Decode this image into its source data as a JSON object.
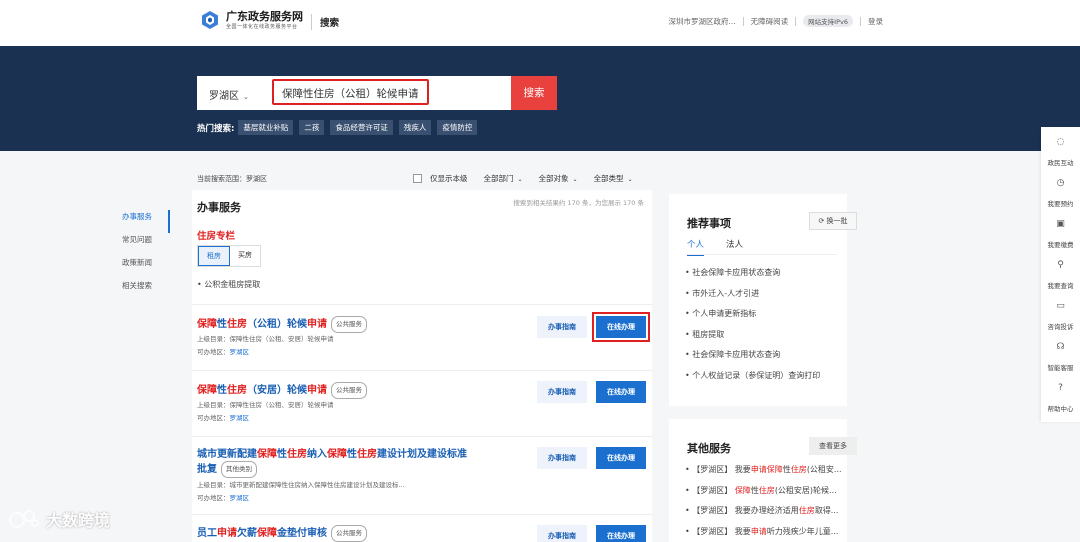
{
  "header": {
    "logo_title": "广东政务服务网",
    "logo_subtitle": "全国一体化在线政务服务平台",
    "page_label": "搜索",
    "location": "深圳市罗湖区政府...",
    "accessibility": "无障碍阅读",
    "ipv6": "网站支持IPv6",
    "login": "登录"
  },
  "search": {
    "region": "罗湖区",
    "query": "保障性住房（公租）轮候申请",
    "button": "搜索",
    "hot_label": "热门搜索:",
    "hot_tags": [
      "基层就业补贴",
      "二孩",
      "食品经营许可证",
      "残疾人",
      "疫情防控"
    ]
  },
  "filters": {
    "scope": "当前搜索范围：罗湖区",
    "sample_only": "仅显示本级",
    "department": "全部部门",
    "object": "全部对象",
    "type": "全部类型"
  },
  "side_nav": [
    "办事服务",
    "常见问题",
    "政策新闻",
    "相关搜索"
  ],
  "results": {
    "title": "办事服务",
    "count": "搜索到相关结果约 170 条，为您展示 170 条",
    "housing_title": "住房专栏",
    "tabs": [
      "租房",
      "买房"
    ],
    "gjj": "公积金租房提取",
    "guide_label": "办事指南",
    "go_label": "在线办理",
    "items": [
      {
        "title_parts": [
          [
            "保障",
            true
          ],
          [
            "性",
            false
          ],
          [
            "住房",
            true
          ],
          [
            "（公租）轮候",
            false
          ],
          [
            "申请",
            true
          ]
        ],
        "badge": "公共服务",
        "parent": "上级目录：保障性住房（公租、安居）轮候申请",
        "area_label": "可办地区：",
        "area": "罗湖区"
      },
      {
        "title_parts": [
          [
            "保障",
            true
          ],
          [
            "性",
            false
          ],
          [
            "住房",
            true
          ],
          [
            "（安居）轮候",
            false
          ],
          [
            "申请",
            true
          ]
        ],
        "badge": "公共服务",
        "parent": "上级目录：保障性住房（公租、安居）轮候申请",
        "area_label": "可办地区：",
        "area": "罗湖区"
      },
      {
        "title_parts": [
          [
            "城市更新配建",
            false
          ],
          [
            "保障",
            true
          ],
          [
            "性",
            false
          ],
          [
            "住房",
            true
          ],
          [
            "纳入",
            false
          ],
          [
            "保障",
            true
          ],
          [
            "性",
            false
          ],
          [
            "住房",
            true
          ],
          [
            "建设计划及建设标准批复",
            false
          ]
        ],
        "badge": "其他类别",
        "parent": "上级目录：城市更新配建保障性住房纳入保障性住房建设计划及建设标...",
        "area_label": "可办地区：",
        "area": "罗湖区"
      },
      {
        "title_parts": [
          [
            "员工",
            false
          ],
          [
            "申请",
            true
          ],
          [
            "欠薪",
            false
          ],
          [
            "保障",
            true
          ],
          [
            "金垫付审核",
            false
          ]
        ],
        "badge": "公共服务",
        "parent": "",
        "area_label": "",
        "area": ""
      }
    ]
  },
  "recommend": {
    "title": "推荐事项",
    "refresh": "换一批",
    "tabs": [
      "个人",
      "法人"
    ],
    "items": [
      "社会保障卡应用状态查询",
      "市外迁入-人才引进",
      "个人申请更新指标",
      "租房提取",
      "社会保障卡应用状态查询",
      "个人权益记录（参保证明）查询打印"
    ]
  },
  "other": {
    "title": "其他服务",
    "more": "查看更多",
    "items": [
      [
        [
          "【罗湖区】 我要",
          false
        ],
        [
          "申请保障",
          true
        ],
        [
          "性",
          false
        ],
        [
          "住房",
          true
        ],
        [
          "(公租安...",
          false
        ]
      ],
      [
        [
          "【罗湖区】 ",
          false
        ],
        [
          "保障",
          true
        ],
        [
          "性",
          false
        ],
        [
          "住房",
          true
        ],
        [
          "(公租安居)轮候...",
          false
        ]
      ],
      [
        [
          "【罗湖区】 我要办理经济适用",
          false
        ],
        [
          "住房",
          true
        ],
        [
          "取得...",
          false
        ]
      ],
      [
        [
          "【罗湖区】 我要",
          false
        ],
        [
          "申请",
          true
        ],
        [
          "听力残疾少年儿童...",
          false
        ]
      ]
    ]
  },
  "float_bar": [
    "政民互动",
    "我要预约",
    "我要缴费",
    "我要查询",
    "咨询投诉",
    "智能客服",
    "帮助中心"
  ],
  "watermark": "大数跨境",
  "colors": {
    "navy": "#1b3152",
    "primary": "#1a6fcf",
    "highlight": "#e02020"
  }
}
